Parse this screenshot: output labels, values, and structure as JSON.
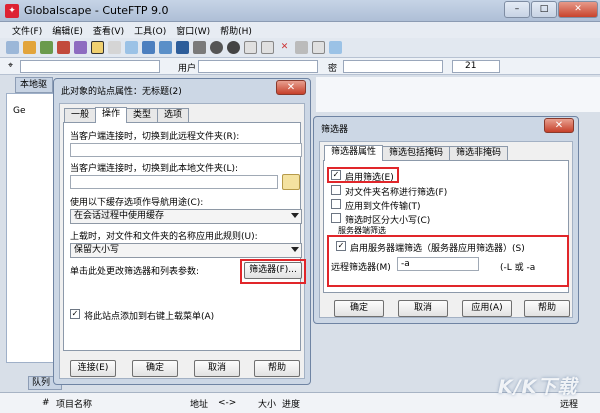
{
  "app": {
    "title": "Globalscape - CuteFTP 9.0",
    "window_buttons": [
      "–",
      "□",
      "✕"
    ]
  },
  "menu": [
    "文件(F)",
    "编辑(E)",
    "查看(V)",
    "工具(O)",
    "窗口(W)",
    "帮助(H)"
  ],
  "quickconnect": {
    "host_value": "",
    "user_label": "用户",
    "password_label": "密",
    "port_value": "21"
  },
  "left_panel": {
    "tab_label": "本地驱",
    "node_label": "Ge"
  },
  "queue": {
    "tab_label": "队列",
    "columns": [
      "#",
      "项目名称",
      "地址",
      "<->",
      "大小",
      "进度",
      "远程"
    ]
  },
  "site_dialog": {
    "title": "此对象的站点属性：无标题(2)",
    "tabs": [
      "一般",
      "操作",
      "类型",
      "选项"
    ],
    "active_tab_index": 1,
    "fields": {
      "remote_folder_label": "当客户端连接时，切换到此远程文件夹(R):",
      "remote_folder_value": "",
      "local_folder_label": "当客户端连接时，切换到此本地文件夹(L):",
      "local_folder_value": "",
      "cache_label": "使用以下缓存选项作导航用途(C):",
      "cache_value": "在会话过程中使用缓存",
      "upload_rule_label": "上载时，对文件和文件夹的名称应用此规则(U):",
      "upload_rule_value": "保留大小写",
      "filter_hint": "单击此处更改筛选器和列表参数:",
      "filter_button": "筛选器(F)...",
      "add_menu_checkbox_label": "将此站点添加到右键上载菜单(A)",
      "add_menu_checked": true
    },
    "buttons": [
      "连接(E)",
      "确定",
      "取消",
      "帮助"
    ]
  },
  "filter_dialog": {
    "title": "筛选器",
    "tabs": [
      "筛选器属性",
      "筛选包括掩码",
      "筛选非掩码"
    ],
    "active_tab_index": 0,
    "options": [
      {
        "label": "启用筛选(E)",
        "checked": true
      },
      {
        "label": "对文件夹名称进行筛选(F)",
        "checked": false
      },
      {
        "label": "应用到文件传输(T)",
        "checked": false
      },
      {
        "label": "筛选时区分大小写(C)",
        "checked": false
      }
    ],
    "server_group_label": "服务器端筛选",
    "server_filter": {
      "label": "启用服务器端筛选（服务器应用筛选器）(S)",
      "checked": true
    },
    "remote_filter_label": "远程筛选器(M)",
    "remote_filter_value": "-a",
    "remote_filter_hint": "(-L 或 -a",
    "buttons": [
      "确定",
      "取消",
      "应用(A)",
      "帮助"
    ]
  },
  "watermark": "K/K下载",
  "colors": {
    "highlight_red": "#e1262a",
    "title_bar": "#ccd7e5"
  }
}
